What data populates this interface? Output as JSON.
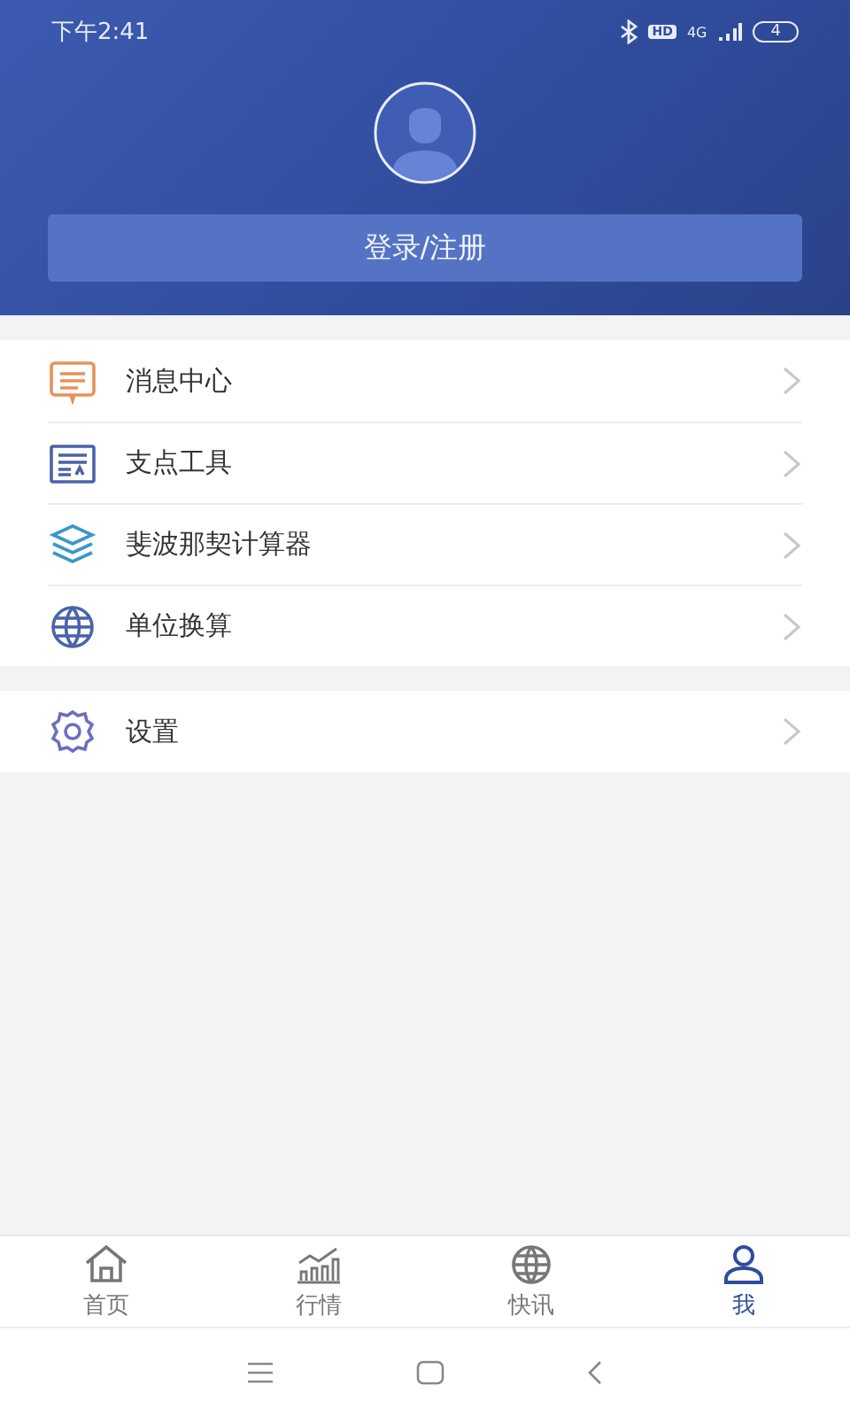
{
  "status_bar": {
    "time": "下午2:41",
    "hd": "HD",
    "network": "4G",
    "battery": "4"
  },
  "profile": {
    "login_button": "登录/注册"
  },
  "menu_groups": [
    {
      "items": [
        {
          "label": "消息中心",
          "kind": "message"
        },
        {
          "label": "支点工具",
          "kind": "tool"
        },
        {
          "label": "斐波那契计算器",
          "kind": "cube"
        },
        {
          "label": "单位换算",
          "kind": "globe"
        }
      ]
    },
    {
      "items": [
        {
          "label": "设置",
          "kind": "gear"
        }
      ]
    }
  ],
  "tab_bar": [
    {
      "label": "首页",
      "kind": "home",
      "selected": false
    },
    {
      "label": "行情",
      "kind": "chart",
      "selected": false
    },
    {
      "label": "快讯",
      "kind": "globe",
      "selected": false
    },
    {
      "label": "我",
      "kind": "user",
      "selected": true
    }
  ]
}
